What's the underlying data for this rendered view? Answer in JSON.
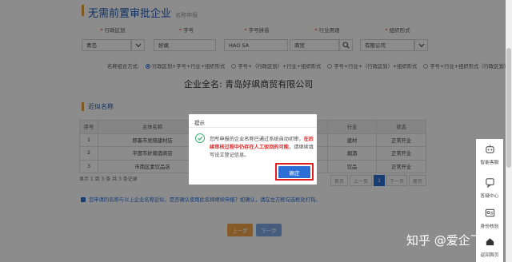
{
  "header": {
    "title": "无需前置审批企业",
    "subtitle": "名称申报"
  },
  "form": {
    "labels": [
      "行政区划",
      "字号",
      "字号拼音",
      "行业用语",
      "组织形式"
    ],
    "region_value": "青岛",
    "region_dropdown": "",
    "tradename_value": "好飒",
    "pinyin_value": "HAO SA",
    "industry_value": "商贸",
    "orgform_value": "有限公司"
  },
  "combination": {
    "label": "名称组合方式:",
    "options": [
      {
        "text": "行政区划+字号+行业+组织形式",
        "selected": true
      },
      {
        "text": "字号+（行政区划）+行业+组织形式",
        "selected": false
      },
      {
        "text": "字号+行业+（行政区划）+组织形式",
        "selected": false
      },
      {
        "text": "字号+行业+组织形式（行政区划）",
        "selected": false
      }
    ]
  },
  "fullname": {
    "label": "企业全名:",
    "value": "青岛好飒商贸有限公司"
  },
  "similar": {
    "title": "近似名称",
    "columns": [
      "序号",
      "主体名称",
      "",
      "行业",
      "状态"
    ],
    "rows": [
      {
        "no": "1",
        "name": "即墨市吴晓建材店",
        "industry": "建材",
        "status": "正常开业"
      },
      {
        "no": "2",
        "name": "平度市好顺酒商店",
        "industry": "烟酒",
        "status": "正常开业"
      },
      {
        "no": "3",
        "name": "市南区素饮品店",
        "industry": "饮品",
        "status": "正常开业"
      }
    ],
    "pager_info": "显示 1 到 3 条 共 3 条记录",
    "pager_buttons": [
      "首页",
      "上一页",
      "1",
      "下一页",
      "尾页"
    ]
  },
  "notice": "您申请的名称与以上企业名称近似，是否确认使用此名称继续申报？如确认，请在左方框勾选框处打钩。",
  "nav": {
    "prev_label": "上一步",
    "next_label": "下一步"
  },
  "dialog": {
    "title": "提示",
    "msg_normal_1": "您所申报的企业名称已通过系统自动初审，",
    "msg_red": "在后续审核过程中仍存在人工驳回的可能",
    "msg_normal_2": "，请继续填写设立登记信息。",
    "ok_label": "确定"
  },
  "sidebar": {
    "items": [
      {
        "label": "智能客服",
        "icon": "robot-icon"
      },
      {
        "label": "答疑中心",
        "icon": "qa-icon"
      },
      {
        "label": "身份核验",
        "icon": "id-card-icon"
      },
      {
        "label": "返回首页",
        "icon": "home-icon"
      }
    ]
  },
  "watermark": "知乎 @爱企飞",
  "colors": {
    "accent": "#2b6fd6",
    "section_bar": "#e8a33c",
    "red_highlight": "#e02020",
    "success": "#3cb371",
    "prev_btn": "#f3a447"
  }
}
